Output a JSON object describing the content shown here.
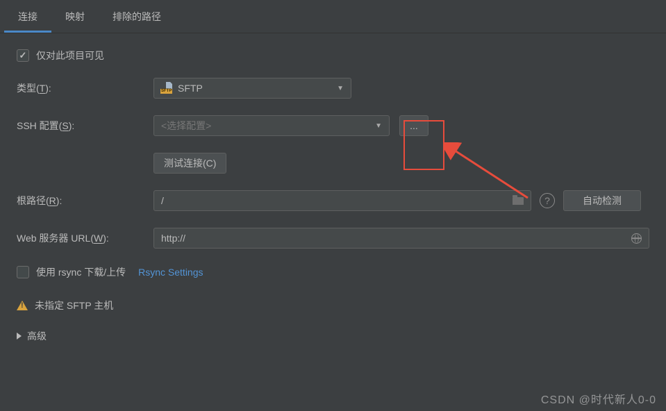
{
  "tabs": {
    "connection": "连接",
    "mappings": "映射",
    "excluded": "排除的路径"
  },
  "checkbox": {
    "visibleOnlyThisProject": "仅对此项目可见"
  },
  "labels": {
    "type": "类型(T):",
    "typeKey": "T",
    "sshConfig": "SSH 配置(S):",
    "sshKey": "S",
    "rootPath": "根路径(R):",
    "rootKey": "R",
    "webUrl": "Web 服务器 URL(W):",
    "webKey": "W"
  },
  "fields": {
    "typeValue": "SFTP",
    "sftpTag": "SFTP",
    "sshPlaceholder": "<选择配置>",
    "rootValue": "/",
    "webValue": "http://"
  },
  "buttons": {
    "browse": "...",
    "testConnection": "测试连接(C)",
    "autoDetect": "自动检测"
  },
  "rsync": {
    "checkboxLabel": "使用 rsync 下载/上传",
    "link": "Rsync Settings"
  },
  "warning": "未指定 SFTP 主机",
  "advanced": "高级",
  "watermark": "CSDN @时代新人0-0"
}
